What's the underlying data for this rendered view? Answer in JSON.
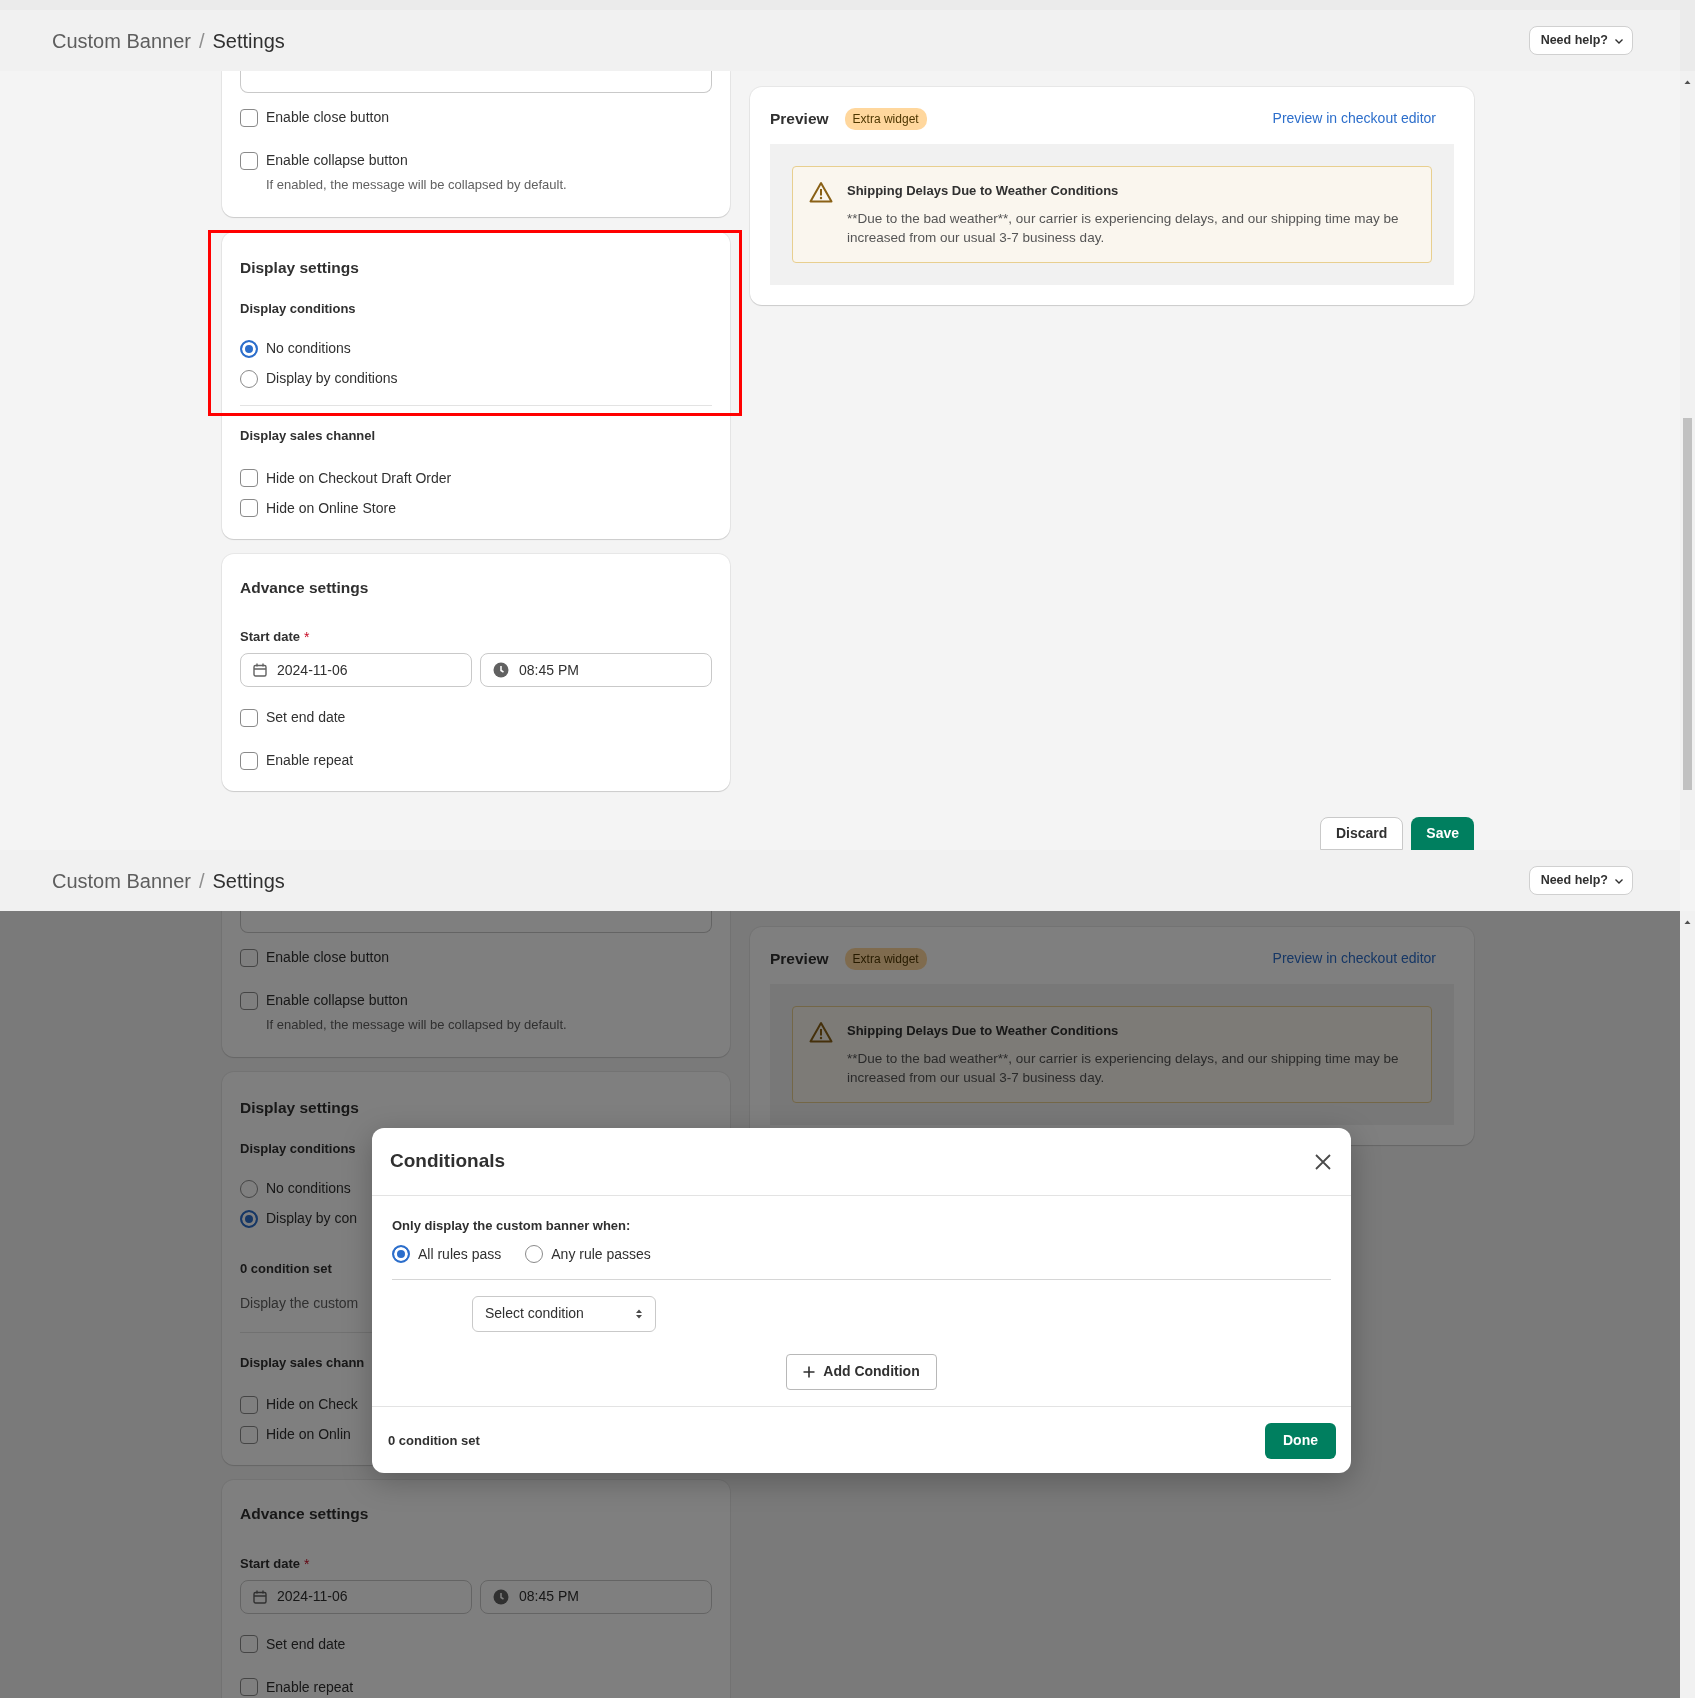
{
  "screens": [
    {
      "header": {
        "parent": "Custom Banner",
        "separator": "/",
        "current": "Settings",
        "help_button": "Need help?"
      },
      "message_options": [
        {
          "label": "Enable close button",
          "checked": false
        },
        {
          "label": "Enable collapse button",
          "checked": false,
          "help": "If enabled, the message will be collapsed by default."
        }
      ],
      "display_settings": {
        "title": "Display settings",
        "highlighted": true,
        "conditions_label": "Display conditions",
        "condition_options": [
          {
            "label": "No conditions",
            "selected": true
          },
          {
            "label": "Display by conditions",
            "selected": false
          }
        ],
        "sales_channel_label": "Display sales channel",
        "sales_channels": [
          {
            "label": "Hide on Checkout Draft Order",
            "checked": false
          },
          {
            "label": "Hide on Online Store",
            "checked": false
          }
        ]
      },
      "advance_settings": {
        "title": "Advance settings",
        "start_date_label": "Start date",
        "required_mark": "*",
        "date": "2024-11-06",
        "time": "08:45 PM",
        "options": [
          {
            "label": "Set end date",
            "checked": false
          },
          {
            "label": "Enable repeat",
            "checked": false
          }
        ]
      },
      "preview": {
        "title": "Preview",
        "badge": "Extra widget",
        "link": "Preview in checkout editor",
        "banner_title": "Shipping Delays Due to Weather Conditions",
        "banner_message": "**Due to the bad weather**, our carrier is experiencing delays, and our shipping time may be increased from our usual 3-7 business day."
      },
      "actions": [
        {
          "label": "Discard",
          "kind": "secondary"
        },
        {
          "label": "Save",
          "kind": "primary"
        }
      ]
    },
    {
      "header": {
        "parent": "Custom Banner",
        "separator": "/",
        "current": "Settings",
        "help_button": "Need help?"
      },
      "message_options": [
        {
          "label": "Enable close button",
          "checked": false
        },
        {
          "label": "Enable collapse button",
          "checked": false,
          "help": "If enabled, the message will be collapsed by default."
        }
      ],
      "display_settings": {
        "title": "Display settings",
        "highlighted": false,
        "conditions_label": "Display conditions",
        "condition_options": [
          {
            "label": "No conditions",
            "selected": false
          },
          {
            "label": "Display by con",
            "selected": true
          }
        ],
        "condition_summary": {
          "count": "0 condition set",
          "description": "Display the custom"
        },
        "sales_channel_label": "Display sales chann",
        "sales_channels": [
          {
            "label": "Hide on Check",
            "checked": false
          },
          {
            "label": "Hide on Onlin",
            "checked": false
          }
        ]
      },
      "advance_settings": {
        "title": "Advance settings",
        "start_date_label": "Start date",
        "required_mark": "*",
        "date": "2024-11-06",
        "time": "08:45 PM",
        "options": [
          {
            "label": "Set end date",
            "checked": false
          },
          {
            "label": "Enable repeat",
            "checked": false
          }
        ]
      },
      "preview": {
        "title": "Preview",
        "badge": "Extra widget",
        "link": "Preview in checkout editor",
        "banner_title": "Shipping Delays Due to Weather Conditions",
        "banner_message": "**Due to the bad weather**, our carrier is experiencing delays, and our shipping time may be increased from our usual 3-7 business day."
      },
      "modal": {
        "title": "Conditionals",
        "prompt": "Only display the custom banner when:",
        "match_options": [
          {
            "label": "All rules pass",
            "selected": true
          },
          {
            "label": "Any rule passes",
            "selected": false
          }
        ],
        "select_value": "Select condition",
        "add_button": "Add Condition",
        "footer_count": "0 condition set",
        "done_button": "Done"
      }
    }
  ]
}
